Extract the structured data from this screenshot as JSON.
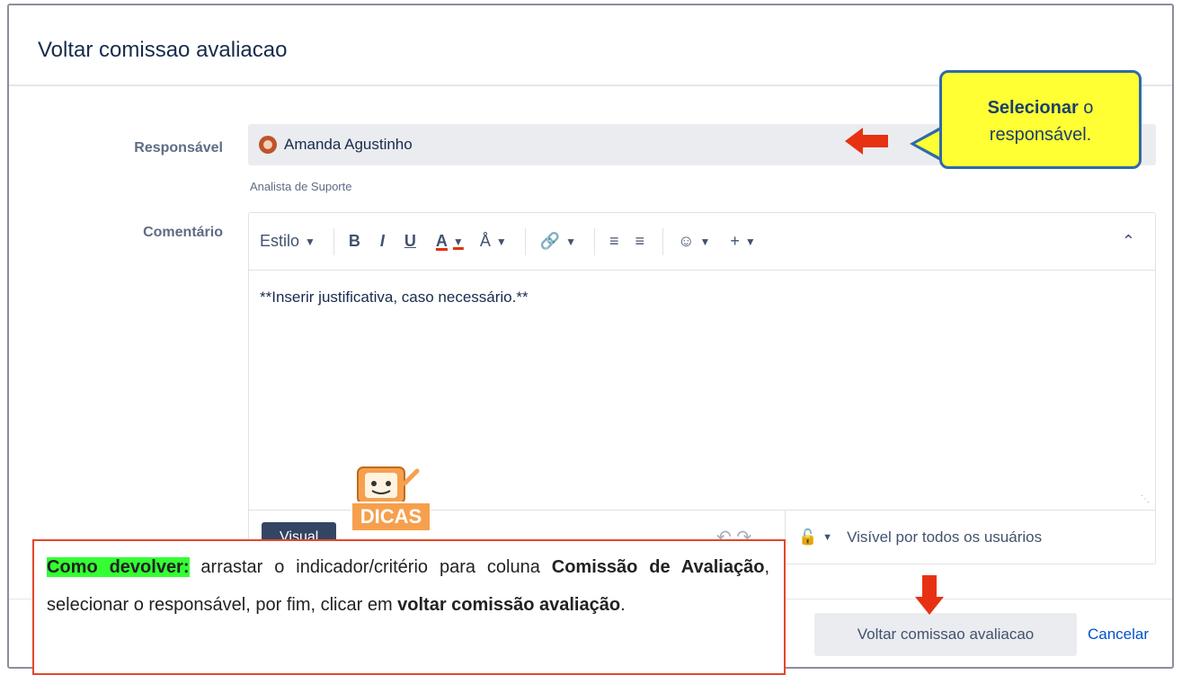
{
  "dialog": {
    "title": "Voltar comissao avaliacao",
    "responsavel_label": "Responsável",
    "responsavel_value": "Amanda Agustinho",
    "responsavel_subtext": "Analista de Suporte",
    "comentario_label": "Comentário",
    "toolbar": {
      "style_label": "Estilo",
      "bold_label": "B",
      "italic_label": "I",
      "underline_label": "U",
      "color_label": "A"
    },
    "comment_text": "**Inserir justificativa, caso necessário.**",
    "visual_tab": "Visual",
    "visibility_text": "Visível por todos os usuários",
    "submit_button": "Voltar comissao avaliacao",
    "cancel_link": "Cancelar"
  },
  "callout": {
    "bold": "Selecionar",
    "rest1": " o",
    "rest2": "responsável."
  },
  "mascot": {
    "label": "DICAS"
  },
  "tip": {
    "highlight": "Como devolver:",
    "part1": " arrastar o indicador/critério para coluna ",
    "bold1": "Comissão de Avaliação",
    "part2": ", selecionar o responsável, por fim, clicar em ",
    "bold2": "voltar comissão avaliação",
    "part3": "."
  },
  "colors": {
    "arrow": "#e63212",
    "callout_bg": "#ffff33",
    "tip_border": "#e2472b",
    "highlight": "#33ff33"
  }
}
